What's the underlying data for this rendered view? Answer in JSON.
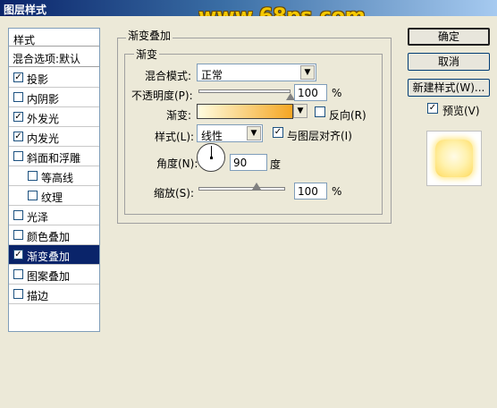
{
  "window": {
    "title": "图层样式",
    "watermark": "www.68ps.com"
  },
  "left_panel": {
    "header": "样式",
    "blend_options": "混合选项:默认",
    "items": [
      {
        "label": "投影",
        "checked": true,
        "selected": false,
        "indent": false
      },
      {
        "label": "内阴影",
        "checked": false,
        "selected": false,
        "indent": false
      },
      {
        "label": "外发光",
        "checked": true,
        "selected": false,
        "indent": false
      },
      {
        "label": "内发光",
        "checked": true,
        "selected": false,
        "indent": false
      },
      {
        "label": "斜面和浮雕",
        "checked": false,
        "selected": false,
        "indent": false
      },
      {
        "label": "等高线",
        "checked": false,
        "selected": false,
        "indent": true
      },
      {
        "label": "纹理",
        "checked": false,
        "selected": false,
        "indent": true
      },
      {
        "label": "光泽",
        "checked": false,
        "selected": false,
        "indent": false
      },
      {
        "label": "颜色叠加",
        "checked": false,
        "selected": false,
        "indent": false
      },
      {
        "label": "渐变叠加",
        "checked": true,
        "selected": true,
        "indent": false
      },
      {
        "label": "图案叠加",
        "checked": false,
        "selected": false,
        "indent": false
      },
      {
        "label": "描边",
        "checked": false,
        "selected": false,
        "indent": false
      }
    ]
  },
  "gradient_overlay": {
    "outer_title": "渐变叠加",
    "inner_title": "渐变",
    "blend_mode_label": "混合模式:",
    "blend_mode_value": "正常",
    "opacity_label": "不透明度(P):",
    "opacity_value": "100",
    "opacity_unit": "%",
    "opacity_level": 1.0,
    "gradient_label": "渐变:",
    "reverse_label": "反向(R)",
    "reverse_checked": false,
    "style_label": "样式(L):",
    "style_value": "线性",
    "align_label": "与图层对齐(I)",
    "align_checked": true,
    "angle_label": "角度(N):",
    "angle_value": "90",
    "angle_unit": "度",
    "scale_label": "缩放(S):",
    "scale_value": "100",
    "scale_unit": "%",
    "scale_level": 0.67
  },
  "buttons": {
    "ok": "确定",
    "cancel": "取消",
    "new_style": "新建样式(W)...",
    "preview_label": "预览(V)",
    "preview_checked": true
  },
  "colors": {
    "selection": "#0a246a",
    "gradient_start": "#fffde0",
    "gradient_end": "#f5a623"
  },
  "check_mark": "✓",
  "arrow_glyph": "▼"
}
